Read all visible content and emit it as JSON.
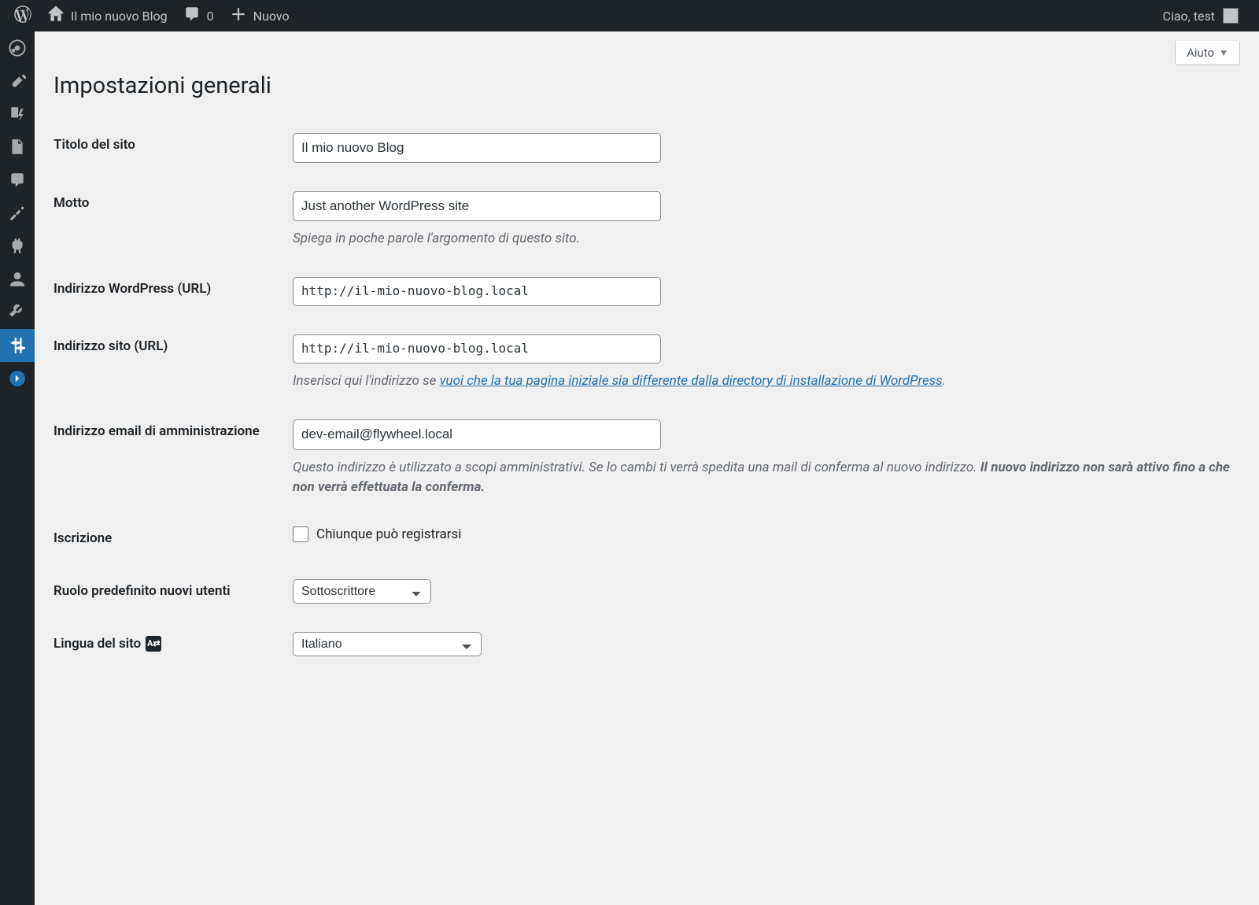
{
  "adminbar": {
    "site_name": "Il mio nuovo Blog",
    "comments_count": "0",
    "new_label": "Nuovo",
    "greeting": "Ciao, test"
  },
  "help": {
    "label": "Aiuto"
  },
  "page": {
    "title": "Impostazioni generali"
  },
  "fields": {
    "site_title": {
      "label": "Titolo del sito",
      "value": "Il mio nuovo Blog"
    },
    "tagline": {
      "label": "Motto",
      "value": "Just another WordPress site",
      "desc": "Spiega in poche parole l'argomento di questo sito."
    },
    "wp_url": {
      "label": "Indirizzo WordPress (URL)",
      "value": "http://il-mio-nuovo-blog.local"
    },
    "site_url": {
      "label": "Indirizzo sito (URL)",
      "value": "http://il-mio-nuovo-blog.local",
      "desc_prefix": "Inserisci qui l'indirizzo se ",
      "desc_link": "vuoi che la tua pagina iniziale sia differente dalla directory di installazione di WordPress",
      "desc_suffix": "."
    },
    "admin_email": {
      "label": "Indirizzo email di amministrazione",
      "value": "dev-email@flywheel.local",
      "desc_part1": "Questo indirizzo è utilizzato a scopi amministrativi. Se lo cambi ti verrà spedita una mail di conferma al nuovo indirizzo. ",
      "desc_strong": "Il nuovo indirizzo non sarà attivo fino a che non verrà effettuata la conferma."
    },
    "membership": {
      "label": "Iscrizione",
      "checkbox_label": "Chiunque può registrarsi"
    },
    "default_role": {
      "label": "Ruolo predefinito nuovi utenti",
      "value": "Sottoscrittore"
    },
    "site_language": {
      "label": "Lingua del sito",
      "value": "Italiano"
    }
  }
}
